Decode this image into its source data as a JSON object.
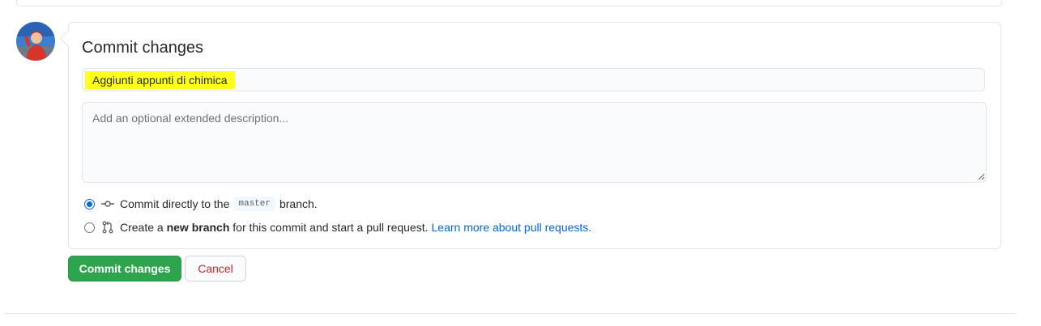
{
  "avatar": {
    "icon": "user-avatar"
  },
  "commit_form": {
    "title": "Commit changes",
    "summary_value": "Aggiunti appunti di chimica",
    "description_placeholder": "Add an optional extended description...",
    "options": [
      {
        "icon": "git-commit-icon",
        "selected": true,
        "prefix": "Commit directly to the",
        "branch": "master",
        "suffix": "branch."
      },
      {
        "icon": "git-pull-request-icon",
        "selected": false,
        "prefix": "Create a",
        "bold": "new branch",
        "suffix": "for this commit and start a pull request.",
        "link": "Learn more about pull requests."
      }
    ]
  },
  "buttons": {
    "commit_label": "Commit changes",
    "cancel_label": "Cancel"
  },
  "colors": {
    "primary_green": "#2ea44f",
    "cancel_red": "#cb2431",
    "link_blue": "#0366d6",
    "highlight_yellow": "#ffff1f"
  }
}
